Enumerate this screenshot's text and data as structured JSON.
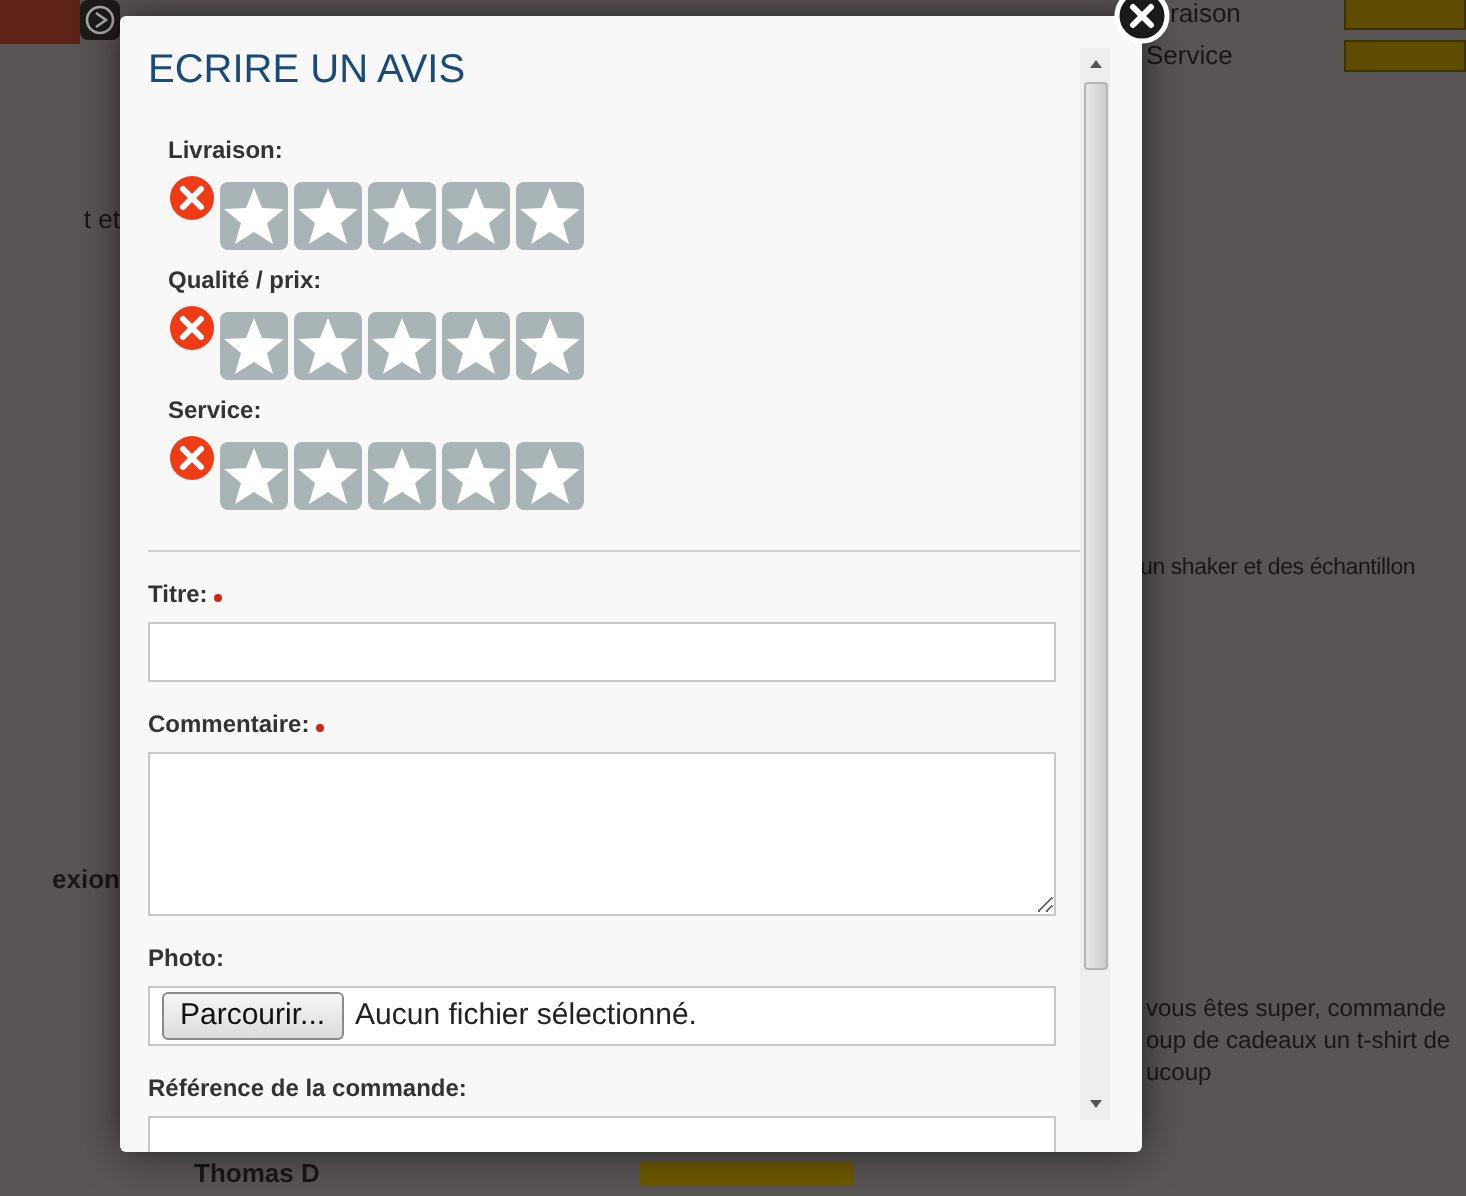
{
  "background": {
    "rating_labels": [
      "raison",
      "Service"
    ],
    "left_texts": [
      {
        "text": "t et",
        "bold": false
      },
      {
        "text": "exion",
        "bold": true
      }
    ],
    "review_lines": [
      "un shaker et des échantillon"
    ],
    "review_lines_2": [
      "vous êtes super, commande",
      "oup de cadeaux un t-shirt de",
      "ucoup"
    ],
    "reviewer": "Thomas D"
  },
  "dialog": {
    "title": "ECRIRE UN AVIS",
    "ratings": [
      {
        "label": "Livraison:",
        "stars": 0
      },
      {
        "label": "Qualité / prix:",
        "stars": 0
      },
      {
        "label": "Service:",
        "stars": 0
      }
    ],
    "fields": [
      {
        "kind": "text",
        "label": "Titre:",
        "required": true
      },
      {
        "kind": "textarea",
        "label": "Commentaire:",
        "required": true
      },
      {
        "kind": "file",
        "label": "Photo:",
        "required": false,
        "button": "Parcourir...",
        "status": "Aucun fichier sélectionné."
      },
      {
        "kind": "text",
        "label": "Référence de la commande:",
        "required": false
      }
    ]
  }
}
